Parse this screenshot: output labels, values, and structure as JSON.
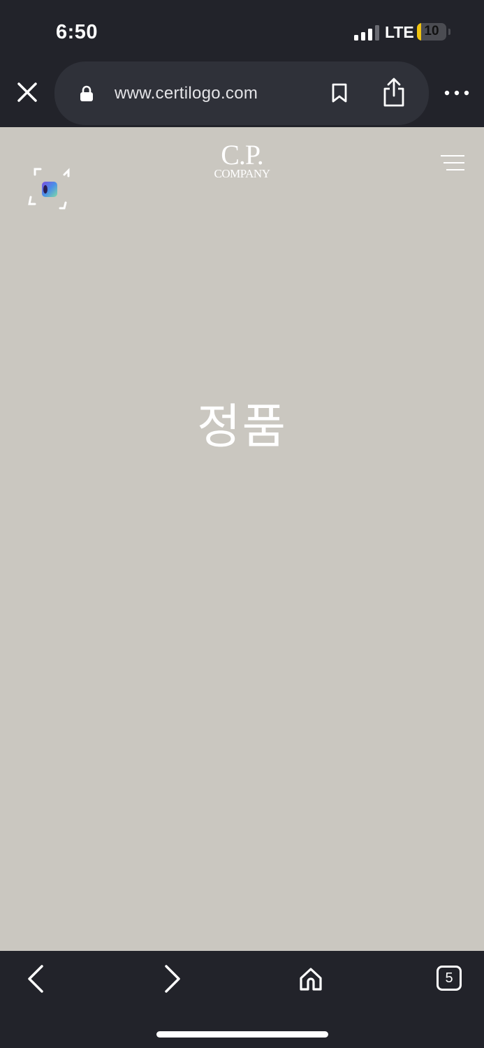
{
  "status_bar": {
    "time": "6:50",
    "network": "LTE",
    "battery_level": "10",
    "battery_fraction": 0.1,
    "signal_bars_active": 3,
    "signal_bars_total": 4
  },
  "browser": {
    "url": "www.certilogo.com",
    "icons": {
      "close": "close-icon",
      "lock": "lock-icon",
      "bookmark": "bookmark-icon",
      "share": "share-icon",
      "more": "more-icon"
    }
  },
  "page": {
    "brand_logo": {
      "line1": "C.P.",
      "line2": "COMPANY"
    },
    "status_text": "정품",
    "icons": {
      "scan": "scan-icon",
      "menu": "menu-icon"
    },
    "background_color": "#cac7c0"
  },
  "bottom_bar": {
    "tab_count": "5",
    "icons": {
      "back": "back-icon",
      "forward": "forward-icon",
      "home": "home-icon",
      "tabs": "tabs-icon"
    }
  },
  "colors": {
    "chrome": "#22232a",
    "url_bar": "#2f3139",
    "battery": "#f1c40f"
  }
}
